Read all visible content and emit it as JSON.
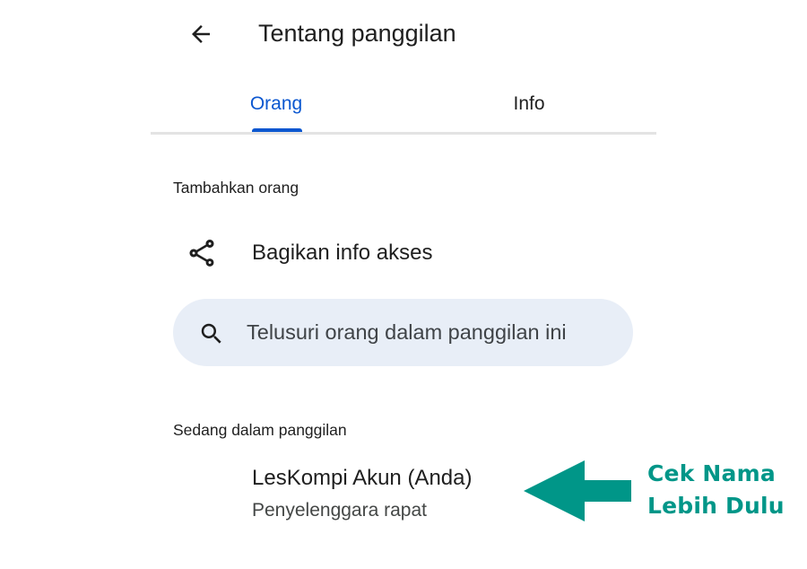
{
  "header": {
    "back_icon": "arrow-left-icon",
    "title": "Tentang panggilan"
  },
  "tabs": [
    {
      "label": "Orang",
      "active": true
    },
    {
      "label": "Info",
      "active": false
    }
  ],
  "add_people": {
    "section_label": "Tambahkan orang",
    "share_icon": "share-icon",
    "share_label": "Bagikan info akses"
  },
  "search": {
    "icon": "search-icon",
    "placeholder": "Telusuri orang dalam panggilan ini",
    "value": ""
  },
  "in_call": {
    "section_label": "Sedang dalam panggilan",
    "participants": [
      {
        "name": "LesKompi Akun (Anda)",
        "role": "Penyelenggara rapat"
      }
    ]
  },
  "annotation": {
    "line1": "Cek Nama",
    "line2": "Lebih Dulu",
    "color": "#009688"
  },
  "colors": {
    "accent": "#0b57d0",
    "search_bg": "#e8eef7"
  }
}
